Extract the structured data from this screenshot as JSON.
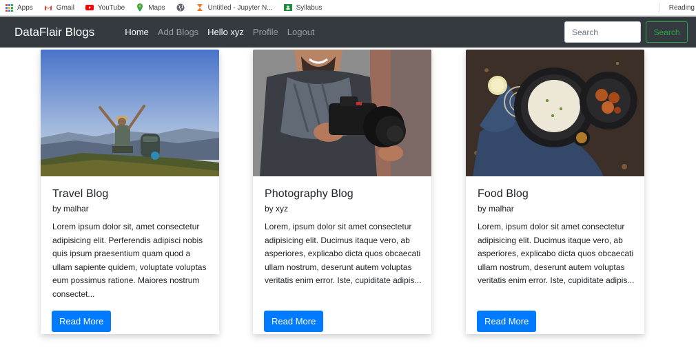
{
  "bookmarks": {
    "items": [
      {
        "label": "Apps",
        "icon": "apps-grid-icon"
      },
      {
        "label": "Gmail",
        "icon": "gmail-icon"
      },
      {
        "label": "YouTube",
        "icon": "youtube-icon"
      },
      {
        "label": "Maps",
        "icon": "maps-icon"
      },
      {
        "label": "",
        "icon": "globe-icon"
      },
      {
        "label": "Untitled - Jupyter N...",
        "icon": "jupyter-icon"
      },
      {
        "label": "Syllabus",
        "icon": "classroom-icon"
      }
    ],
    "reading_list": "Reading"
  },
  "navbar": {
    "brand": "DataFlair Blogs",
    "links": [
      {
        "label": "Home",
        "active": true
      },
      {
        "label": "Add Blogs",
        "active": false
      },
      {
        "label": "Hello xyz",
        "active": true
      },
      {
        "label": "Profile",
        "active": false
      },
      {
        "label": "Logout",
        "active": false
      }
    ],
    "search_placeholder": "Search",
    "search_button": "Search"
  },
  "cards": [
    {
      "title": "Travel Blog",
      "author": "by malhar",
      "text": "Lorem ipsum dolor sit, amet consectetur adipisicing elit. Perferendis adipisci nobis quis ipsum praesentium quam quod a ullam sapiente quidem, voluptate voluptas eum possimus ratione. Maiores nostrum consectet...",
      "button": "Read More",
      "image": "hiker-on-mountain"
    },
    {
      "title": "Photography Blog",
      "author": "by xyz",
      "text": "Lorem, ipsum dolor sit amet consectetur adipisicing elit. Ducimus itaque vero, ab asperiores, explicabo dicta quos obcaecati ullam nostrum, deserunt autem voluptas veritatis enim error. Iste, cupiditate adipis...",
      "button": "Read More",
      "image": "photographer-with-camera"
    },
    {
      "title": "Food Blog",
      "author": "by malhar",
      "text": "Lorem, ipsum dolor sit amet consectetur adipisicing elit. Ducimus itaque vero, ab asperiores, explicabo dicta quos obcaecati ullam nostrum, deserunt autem voluptas veritatis enim error. Iste, cupiditate adipis...",
      "button": "Read More",
      "image": "rice-and-curry-plates"
    }
  ],
  "colors": {
    "navbar_bg": "#343a40",
    "primary": "#007bff",
    "success": "#28a745"
  }
}
